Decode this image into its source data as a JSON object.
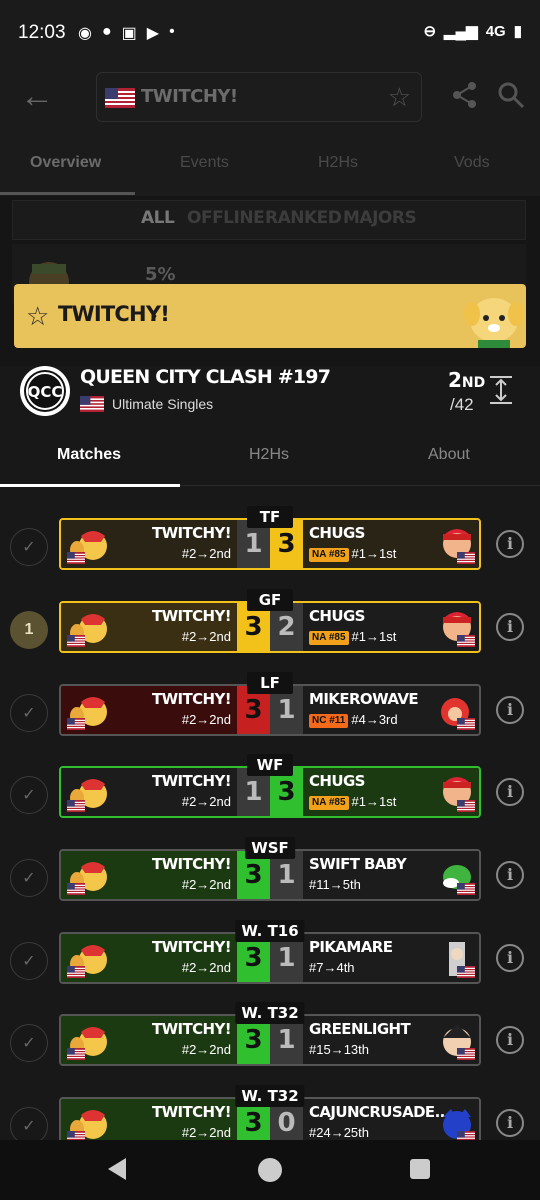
{
  "status_bar": {
    "time": "12:03",
    "network": "4G"
  },
  "header": {
    "search_title": "TWITCHY!"
  },
  "tabs": [
    {
      "label": "Overview",
      "active": true
    },
    {
      "label": "Events"
    },
    {
      "label": "H2Hs"
    },
    {
      "label": "Vods"
    }
  ],
  "filters": [
    "ALL",
    "OFFLINE",
    "RANKED",
    "MAJORS"
  ],
  "usage_pct": "5%",
  "player_card": {
    "name": "TWITCHY!",
    "chevron": "›",
    "accent": "#e8c25a"
  },
  "event": {
    "title": "QUEEN CITY CLASH #197",
    "subtitle": "Ultimate Singles",
    "placement": "2",
    "placement_suffix": "ND",
    "entrants": "/42"
  },
  "subtabs": [
    {
      "label": "Matches",
      "active": true
    },
    {
      "label": "H2Hs"
    },
    {
      "label": "About"
    }
  ],
  "matches": [
    {
      "round": "TF",
      "status": "✓",
      "left_name": "TWITCHY!",
      "left_seed": "#2→2nd",
      "left_score": "1",
      "right_score": "3",
      "right_name": "CHUGS",
      "right_badge": "NA #85",
      "right_seed": "#1→1st",
      "style": "loss-gold"
    },
    {
      "round": "GF",
      "status": "1",
      "left_name": "TWITCHY!",
      "left_seed": "#2→2nd",
      "left_score": "3",
      "right_score": "2",
      "right_name": "CHUGS",
      "right_badge": "NA #85",
      "right_seed": "#1→1st",
      "style": "win-gold"
    },
    {
      "round": "LF",
      "status": "✓",
      "left_name": "TWITCHY!",
      "left_seed": "#2→2nd",
      "left_score": "3",
      "right_score": "1",
      "right_name": "MIKEROWAVE",
      "right_badge": "NC #11",
      "right_seed": "#4→3rd",
      "style": "win-red"
    },
    {
      "round": "WF",
      "status": "✓",
      "left_name": "TWITCHY!",
      "left_seed": "#2→2nd",
      "left_score": "1",
      "right_score": "3",
      "right_name": "CHUGS",
      "right_badge": "NA #85",
      "right_seed": "#1→1st",
      "style": "loss-green"
    },
    {
      "round": "WSF",
      "status": "✓",
      "left_name": "TWITCHY!",
      "left_seed": "#2→2nd",
      "left_score": "3",
      "right_score": "1",
      "right_name": "SWIFT BABY",
      "right_badge": "",
      "right_seed": "#11→5th",
      "style": "win-green"
    },
    {
      "round": "W. T16",
      "status": "✓",
      "left_name": "TWITCHY!",
      "left_seed": "#2→2nd",
      "left_score": "3",
      "right_score": "1",
      "right_name": "PIKAMARE",
      "right_badge": "",
      "right_seed": "#7→4th",
      "style": "win-green"
    },
    {
      "round": "W. T32",
      "status": "✓",
      "left_name": "TWITCHY!",
      "left_seed": "#2→2nd",
      "left_score": "3",
      "right_score": "1",
      "right_name": "GREENLIGHT",
      "right_badge": "",
      "right_seed": "#15→13th",
      "style": "win-green"
    },
    {
      "round": "W. T32",
      "status": "✓",
      "left_name": "TWITCHY!",
      "left_seed": "#2→2nd",
      "left_score": "3",
      "right_score": "0",
      "right_name": "CAJUNCRUSADE...",
      "right_badge": "",
      "right_seed": "#24→25th",
      "style": "win-green"
    }
  ],
  "colors": {
    "gold": "#f2c21a",
    "green": "#2fbf2f",
    "red": "#c62020",
    "badge_na": "#f2a11a",
    "badge_nc": "#f26a1a"
  }
}
